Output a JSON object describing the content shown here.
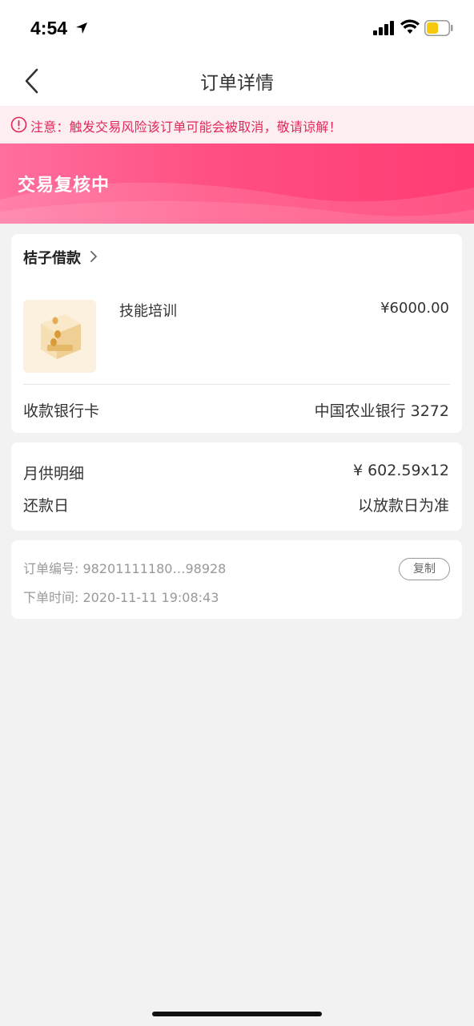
{
  "status_bar": {
    "time": "4:54"
  },
  "nav": {
    "title": "订单详情"
  },
  "notice": {
    "text": "注意：触发交易风险该订单可能会被取消，敬请谅解！"
  },
  "banner": {
    "status": "交易复核中"
  },
  "order": {
    "merchant": "桔子借款",
    "product_name": "技能培训",
    "product_price": "¥6000.00",
    "bank_label": "收款银行卡",
    "bank_value": "中国农业银行 3272"
  },
  "repayment": {
    "monthly_label": "月供明细",
    "monthly_value": "¥ 602.59x12",
    "due_label": "还款日",
    "due_value": "以放款日为准"
  },
  "meta": {
    "order_no": "订单编号: 98201111180…98928",
    "order_time": "下单时间: 2020-11-11 19:08:43",
    "copy_label": "复制"
  },
  "colors": {
    "accent": "#ff4f82",
    "notice_bg": "#fdeef1",
    "notice_text": "#e2285a",
    "page_bg": "#f2f2f2"
  }
}
